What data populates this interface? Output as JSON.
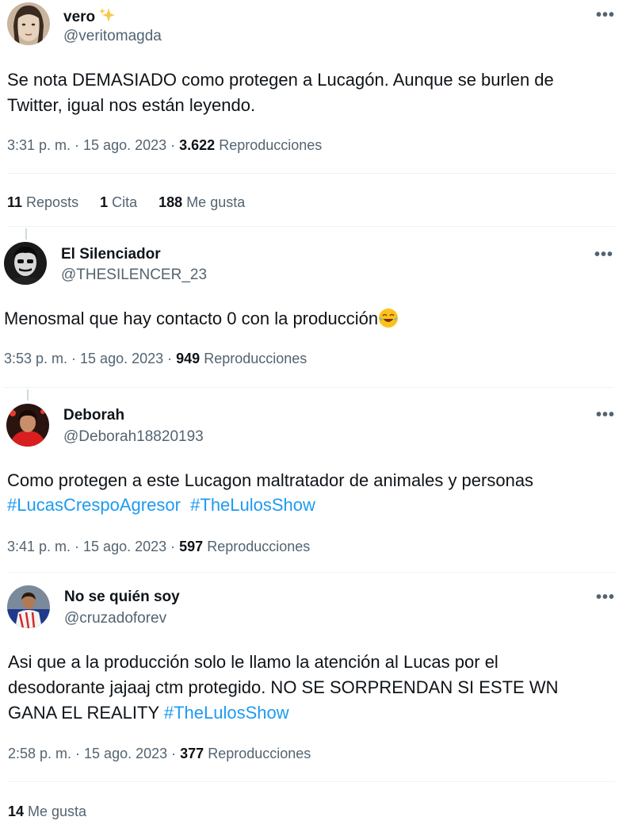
{
  "main_tweet": {
    "name": "vero",
    "handle": "@veritomagda",
    "text_line1": "Se nota DEMASIADO como protegen a Lucagón. Aunque se burlen de",
    "text_line2": "Twitter, igual nos están leyendo.",
    "time": "3:31 p. m. · 15 ago. 2023 · ",
    "views": "3.622",
    "views_label": " Reproducciones",
    "reposts_count": "11",
    "reposts_label": " Reposts",
    "quotes_count": "1",
    "quotes_label": " Cita",
    "likes_count": "188",
    "likes_label": " Me gusta"
  },
  "replies": [
    {
      "name": "El Silenciador",
      "handle": "@THESILENCER_23",
      "text": "Menosmal que hay contacto 0 con la producción",
      "time": "3:53 p. m. · 15 ago. 2023 · ",
      "views": "949",
      "views_label": " Reproducciones"
    },
    {
      "name": "Deborah",
      "handle": "@Deborah18820193",
      "text": "Como protegen a este Lucagon maltratador de animales y personas",
      "hashtag1": "#LucasCrespoAgresor",
      "hashtag2": "#TheLulosShow",
      "time": "3:41 p. m. · 15 ago. 2023 · ",
      "views": "597",
      "views_label": " Reproducciones"
    },
    {
      "name": "No se quién soy",
      "handle": "@cruzadoforev",
      "text_line1": "Asi que a la producción solo le llamo la atención al Lucas por el",
      "text_line2": "desodorante jajaaj ctm protegido. NO SE SORPRENDAN SI ESTE WN",
      "text_line3": "GANA EL REALITY ",
      "hashtag": "#TheLulosShow",
      "time": "2:58 p. m. · 15 ago. 2023 · ",
      "views": "377",
      "views_label": " Reproducciones",
      "likes_count": "14",
      "likes_label": " Me gusta"
    }
  ],
  "more_label": "•••",
  "colors": {
    "text": "#0f1419",
    "secondary": "#536471",
    "link": "#1d9bf0",
    "divider": "#eff3f4"
  },
  "icons": [
    "sparkles-icon",
    "more-icon",
    "joy-emoji-icon"
  ]
}
